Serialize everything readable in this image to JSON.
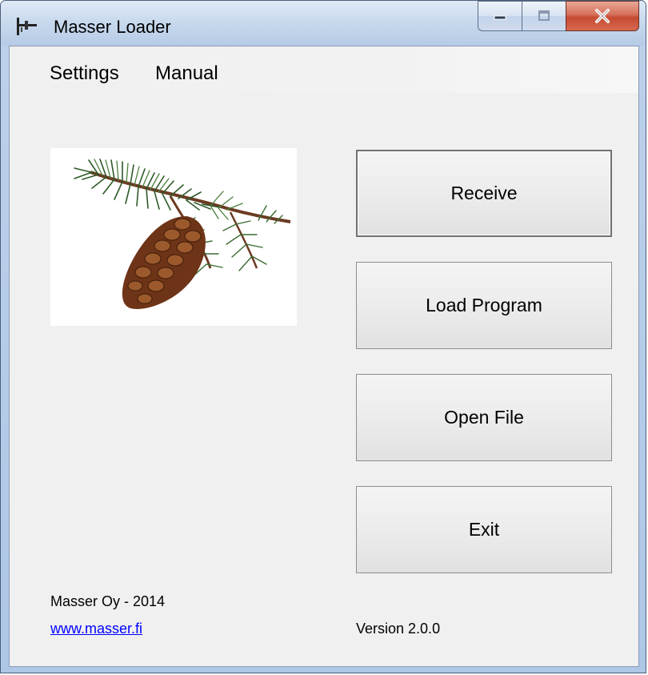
{
  "window": {
    "title": "Masser Loader",
    "app_icon": "masser-app-icon",
    "controls": [
      "minimize-icon",
      "maximize-icon",
      "close-icon"
    ]
  },
  "menu": {
    "items": [
      {
        "label": "Settings"
      },
      {
        "label": "Manual"
      }
    ]
  },
  "logo": {
    "icon": "pine-cone-branch-icon"
  },
  "buttons": {
    "receive": "Receive",
    "load_program": "Load Program",
    "open_file": "Open File",
    "exit": "Exit"
  },
  "footer": {
    "company": "Masser Oy - 2014",
    "website": "www.masser.fi",
    "version": "Version 2.0.0"
  },
  "colors": {
    "client_background": "#f0f0f0",
    "link": "#0000ff",
    "close_button": "#c54a32"
  }
}
